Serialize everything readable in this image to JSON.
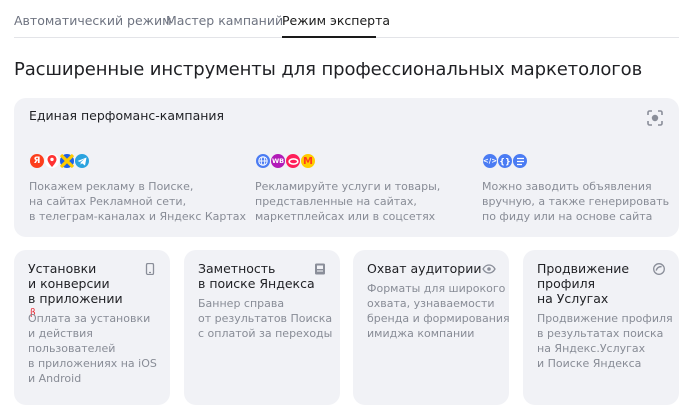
{
  "tabs": [
    {
      "label": "Автоматический режим"
    },
    {
      "label": "Мастер кампаний"
    },
    {
      "label": "Режим эксперта"
    }
  ],
  "page_title": "Расширенные инструменты для профессиональных маркетологов",
  "perf_card": {
    "title": "Единая перфоманс-кампания",
    "columns": [
      {
        "icons": [
          "yandex-logo-icon",
          "maps-pin-icon",
          "yandex-services-icon",
          "telegram-icon"
        ],
        "lines": [
          "Покажем рекламу в Поиске,",
          "на сайтах Рекламной сети,",
          "в телеграм-каналах и Яндекс Картах"
        ]
      },
      {
        "icons": [
          "globe-icon",
          "wildberries-icon",
          "ozon-icon",
          "yandex-market-icon"
        ],
        "lines": [
          "Рекламируйте услуги и товары,",
          "представленные на сайтах,",
          "маркетплейсах или в соцсетях"
        ]
      },
      {
        "icons": [
          "code-icon",
          "brackets-icon",
          "document-icon"
        ],
        "lines": [
          "Можно заводить объявления",
          "вручную, а также генерировать",
          "по фиду или на основе сайта"
        ]
      }
    ]
  },
  "cards": [
    {
      "title_lines": [
        "Установки",
        "и конверсии",
        "в приложении"
      ],
      "badge": "β",
      "icon": "phone-icon",
      "desc_lines": [
        "Оплата за установки",
        "и действия",
        "пользователей",
        "в приложениях на iOS",
        "и Android"
      ]
    },
    {
      "title_lines": [
        "Заметность",
        "в поиске Яндекса"
      ],
      "icon": "search-page-icon",
      "desc_lines": [
        "Баннер справа",
        "от результатов Поиска",
        "с оплатой за переходы"
      ]
    },
    {
      "title_lines": [
        "Охват аудитории"
      ],
      "icon": "eye-icon",
      "desc_lines": [
        "Форматы для широкого",
        "охвата, узнаваемости",
        "бренда и формирования",
        "имиджа компании"
      ]
    },
    {
      "title_lines": [
        "Продвижение",
        "профиля",
        "на Услугах"
      ],
      "icon": "services-icon",
      "desc_lines": [
        "Продвижение профиля",
        "в результатах поиска",
        "на Яндекс.Услугах",
        "и Поиске Яндекса"
      ]
    }
  ],
  "colors": {
    "card_bg": "#f1f2f6",
    "muted_text": "#888c96",
    "beta_red": "#e8242f"
  }
}
